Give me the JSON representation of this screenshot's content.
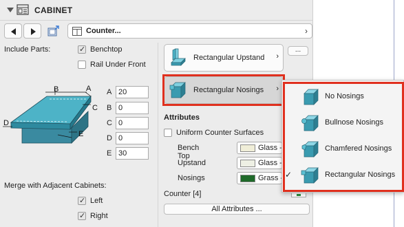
{
  "header": {
    "title": "CABINET"
  },
  "nav": {
    "selector_text": "Counter...",
    "selector_chevron": "›"
  },
  "left": {
    "include_parts_label": "Include Parts:",
    "benchtop_label": "Benchtop",
    "benchtop_checked": true,
    "rail_label": "Rail Under Front",
    "rail_checked": false,
    "diagram_labels": {
      "a": "A",
      "b": "B",
      "c": "C",
      "d": "D",
      "e": "E"
    },
    "dimensions": [
      {
        "label": "A",
        "value": "20"
      },
      {
        "label": "B",
        "value": "0"
      },
      {
        "label": "C",
        "value": "0"
      },
      {
        "label": "D",
        "value": "0"
      },
      {
        "label": "E",
        "value": "30"
      }
    ],
    "merge_label": "Merge with Adjacent Cabinets:",
    "left_label": "Left",
    "left_checked": true,
    "right_label": "Right",
    "right_checked": true
  },
  "right": {
    "upstand_btn": "Rectangular Upstand",
    "nosing_btn": "Rectangular Nosings",
    "chevron": "›",
    "ellipsis": "...",
    "attributes_title": "Attributes",
    "uniform_label": "Uniform Counter Surfaces",
    "uniform_checked": false,
    "materials": [
      {
        "label": "Bench Top",
        "value": "Glass - ",
        "swatch": "#f0eed8"
      },
      {
        "label": "Upstand",
        "value": "Glass - ",
        "swatch": "#eef0e4"
      },
      {
        "label": "Nosings",
        "value": "Grass - ",
        "swatch": "#1f6a2a"
      }
    ],
    "counter_label": "Counter [4]",
    "all_attributes": "All Attributes ..."
  },
  "menu": {
    "items": [
      {
        "label": "No Nosings",
        "selected": false
      },
      {
        "label": "Bullnose Nosings",
        "selected": false
      },
      {
        "label": "Chamfered Nosings",
        "selected": false
      },
      {
        "label": "Rectangular Nosings",
        "selected": true
      }
    ],
    "check_glyph": "✓"
  },
  "colors": {
    "highlight": "#e0301e",
    "countertop": "#3a9bb0"
  }
}
